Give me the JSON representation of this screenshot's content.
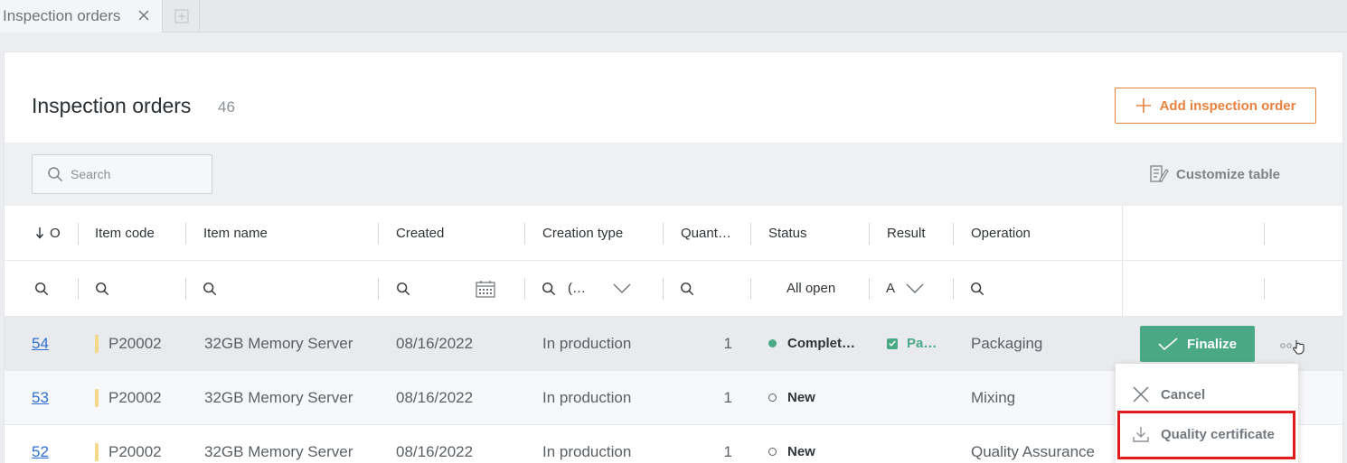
{
  "tabs": [
    {
      "label": "Inspection orders"
    }
  ],
  "header": {
    "title": "Inspection orders",
    "count": "46",
    "add_button_label": "Add inspection order"
  },
  "toolbar": {
    "search_placeholder": "Search",
    "customize_label": "Customize table"
  },
  "columns": [
    {
      "label": "O",
      "sort": "descending"
    },
    {
      "label": "Item code"
    },
    {
      "label": "Item name"
    },
    {
      "label": "Created"
    },
    {
      "label": "Creation type"
    },
    {
      "label": "Quant…"
    },
    {
      "label": "Status"
    },
    {
      "label": "Result"
    },
    {
      "label": "Operation"
    }
  ],
  "filters": {
    "creation_type": "(…",
    "status": "All open",
    "result": "A"
  },
  "rows": [
    {
      "order": "54",
      "item_code": "P20002",
      "item_name": "32GB Memory Server",
      "created": "08/16/2022",
      "creation_type": "In production",
      "quantity": "1",
      "status": "Complet…",
      "result": "Pa…",
      "operation": "Packaging"
    },
    {
      "order": "53",
      "item_code": "P20002",
      "item_name": "32GB Memory Server",
      "created": "08/16/2022",
      "creation_type": "In production",
      "quantity": "1",
      "status": "New",
      "result": "",
      "operation": "Mixing"
    },
    {
      "order": "52",
      "item_code": "P20002",
      "item_name": "32GB Memory Server",
      "created": "08/16/2022",
      "creation_type": "In production",
      "quantity": "1",
      "status": "New",
      "result": "",
      "operation": "Quality Assurance"
    }
  ],
  "row_actions": {
    "finalize_label": "Finalize"
  },
  "menu": {
    "items": [
      {
        "label": "Cancel",
        "icon": "close-icon"
      },
      {
        "label": "Quality certificate",
        "icon": "download-icon"
      }
    ]
  },
  "colors": {
    "accent": "#e8813d",
    "success": "#4aa886",
    "link": "#2f6fd0",
    "highlight": "#e01b1b"
  }
}
